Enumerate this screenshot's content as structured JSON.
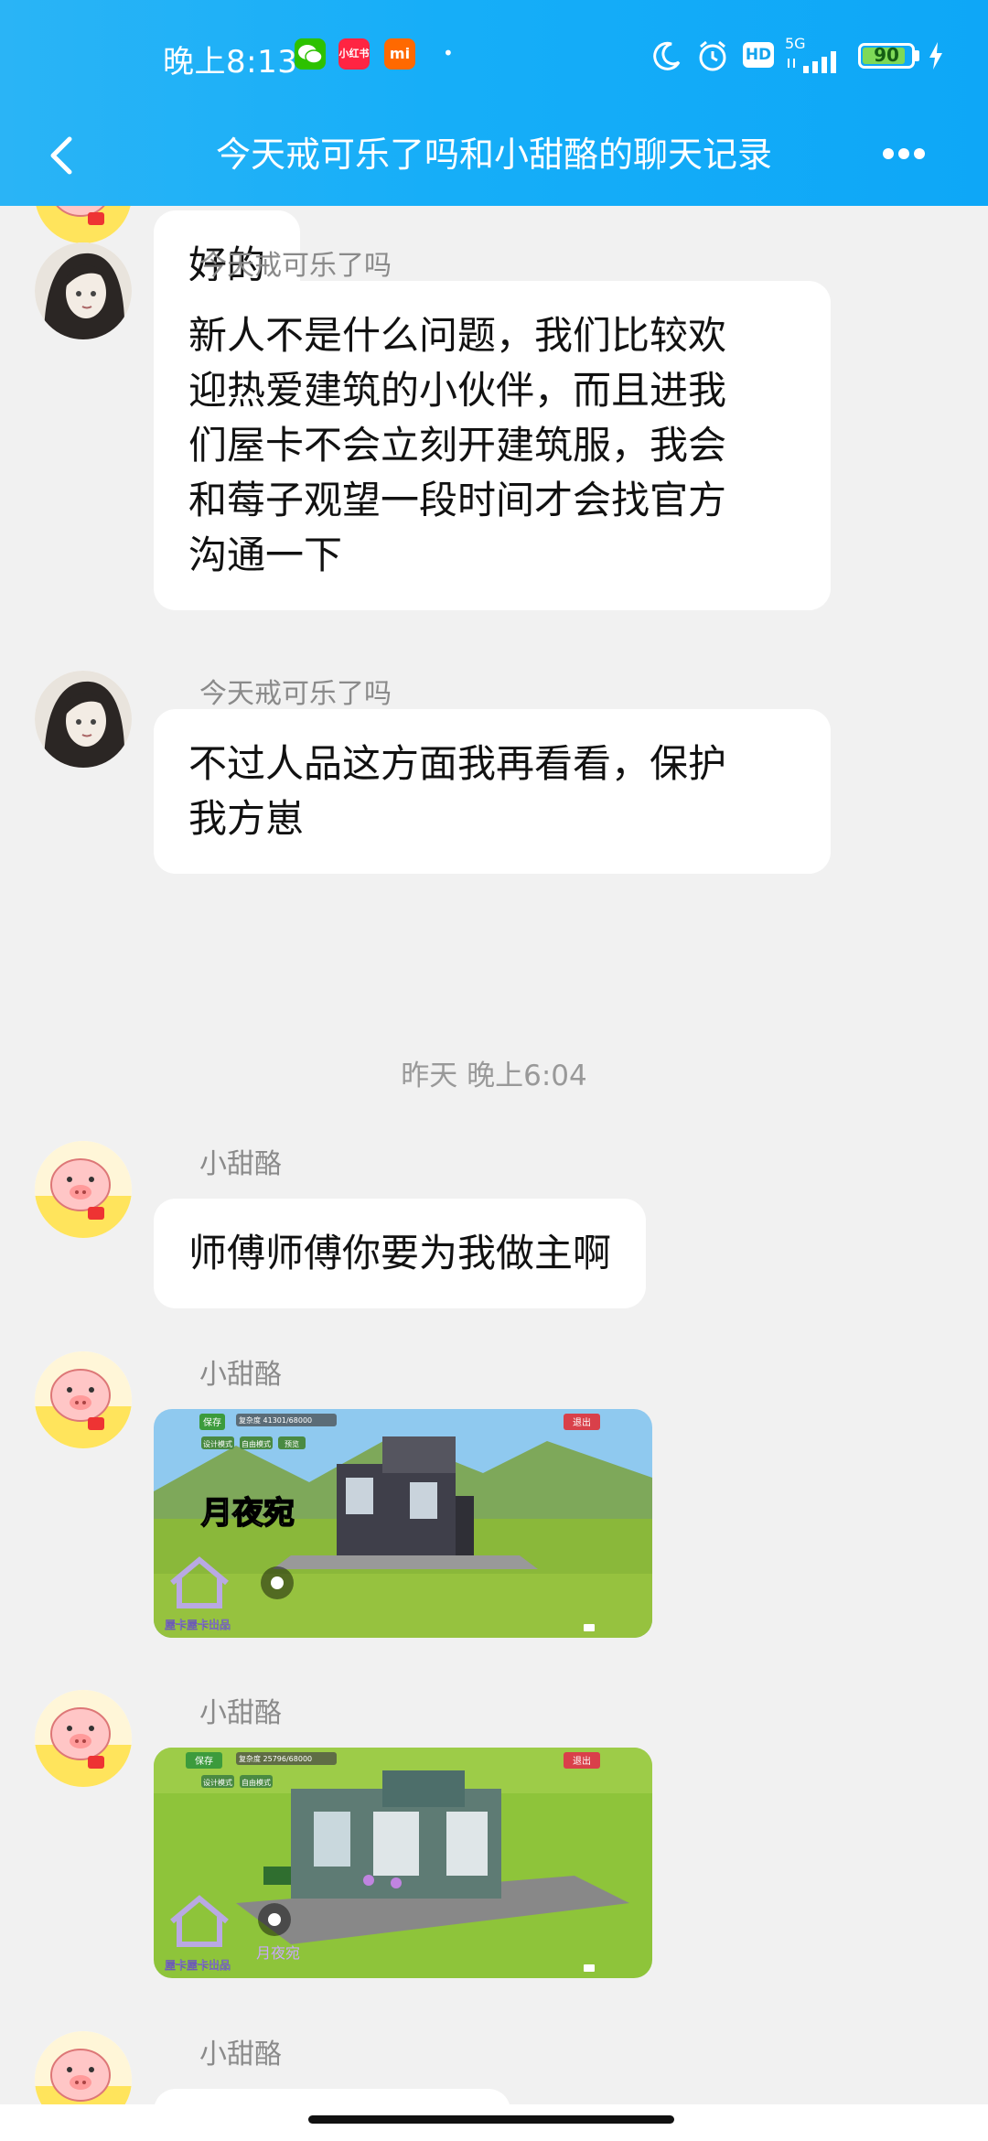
{
  "status_bar": {
    "time": "晚上8:13",
    "apps": [
      {
        "icon": "wechat-icon",
        "label": "",
        "color": "#2dc100"
      },
      {
        "icon": "xiaohongshu-icon",
        "label": "小红书",
        "color": "#ff2442"
      },
      {
        "icon": "mi-icon",
        "label": "mi",
        "color": "#ff6900"
      }
    ],
    "network": "5G",
    "hd": "HD",
    "battery": 90
  },
  "header": {
    "title": "今天戒可乐了吗和小甜酪的聊天记录"
  },
  "messages": [
    {
      "sender": "",
      "text": "好的"
    },
    {
      "sender": "今天戒可乐了吗",
      "text": "新人不是什么问题，我们比较欢\n迎热爱建筑的小伙伴，而且进我\n们屋卡不会立刻开建筑服，我会\n和莓子观望一段时间才会找官方\n沟通一下"
    },
    {
      "sender": "今天戒可乐了吗",
      "text": "不过人品这方面我再看看，保护\n我方崽"
    },
    {
      "timestamp": "昨天 晚上6:04"
    },
    {
      "sender": "小甜酪",
      "text": "师傅师傅你要为我做主啊"
    },
    {
      "sender": "小甜酪",
      "image": {
        "save": "保存",
        "info": "复杂度 41301/68000",
        "exit": "退出",
        "mode1": "设计模式",
        "mode2": "自由模式",
        "preview": "预览",
        "caption": "月夜宛",
        "logo_text": "屋卡屋卡出品"
      }
    },
    {
      "sender": "小甜酪",
      "image": {
        "save": "保存",
        "info": "复杂度 25796/68000",
        "exit": "退出",
        "mode1": "设计模式",
        "mode2": "自由模式",
        "caption": "月夜宛",
        "logo_text": "屋卡屋卡出品"
      }
    },
    {
      "sender": "小甜酪"
    }
  ]
}
